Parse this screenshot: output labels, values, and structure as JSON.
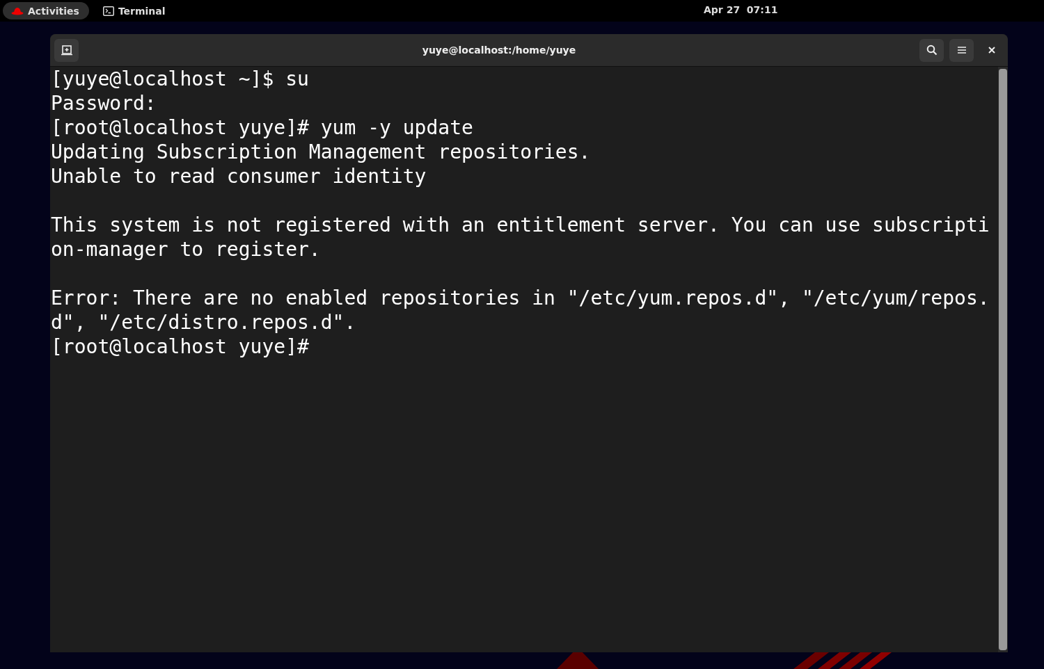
{
  "top_bar": {
    "activities": "Activities",
    "app": "Terminal",
    "clock": "Apr 27  07:11"
  },
  "window": {
    "title": "yuye@localhost:/home/yuye"
  },
  "terminal": {
    "lines": [
      {
        "kind": "text",
        "text": "[yuye@localhost ~]$ su"
      },
      {
        "kind": "text",
        "text": "Password:"
      },
      {
        "kind": "text",
        "text": "[root@localhost yuye]# yum -y update"
      },
      {
        "kind": "text",
        "text": "Updating Subscription Management repositories."
      },
      {
        "kind": "text",
        "text": "Unable to read consumer identity"
      },
      {
        "kind": "blank"
      },
      {
        "kind": "text",
        "text": "This system is not registered with an entitlement server. You can use subscripti"
      },
      {
        "kind": "text",
        "text": "on-manager to register."
      },
      {
        "kind": "blank"
      },
      {
        "kind": "text",
        "text": "Error: There are no enabled repositories in \"/etc/yum.repos.d\", \"/etc/yum/repos."
      },
      {
        "kind": "text",
        "text": "d\", \"/etc/distro.repos.d\"."
      },
      {
        "kind": "text",
        "text": "[root@localhost yuye]#"
      }
    ]
  }
}
